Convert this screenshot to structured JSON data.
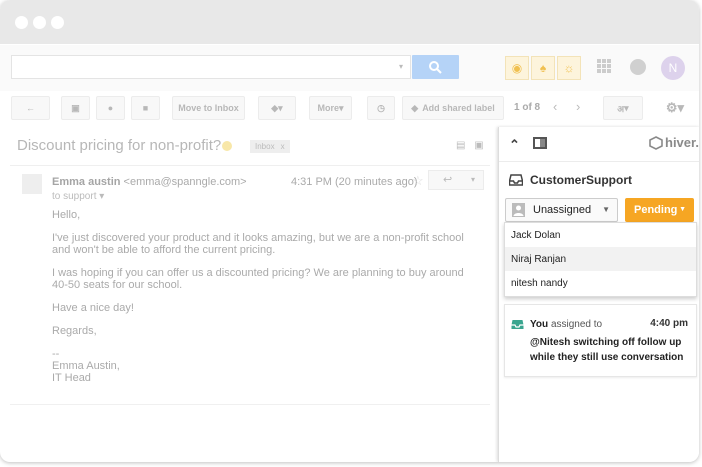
{
  "search": {
    "placeholder": ""
  },
  "account": {
    "avatar_letter": "N",
    "avatar_color": "#ddd2ec"
  },
  "toolbar": {
    "move_to_inbox": "Move to Inbox",
    "more": "More",
    "add_shared_label": "Add shared label",
    "pagination": "1 of 8",
    "lang": "अ"
  },
  "email": {
    "subject": "Discount pricing for non-profit?",
    "label": "Inbox",
    "label_close": "x",
    "sender_name": "Emma austin",
    "sender_email": "<emma@spanngle.com>",
    "time": "4:31 PM (20 minutes ago)",
    "to_line": "to support",
    "body": [
      "Hello,",
      "I've just discovered your product and it looks amazing, but we are a non-profit school and won't be able to afford the current pricing.",
      "I was hoping if you can offer us a discounted pricing? We are planning to buy around 40-50 seats for our school.",
      "Have a nice day!",
      "Regards,"
    ],
    "signature": [
      "--",
      "Emma Austin,",
      "IT Head"
    ]
  },
  "hiver": {
    "brand": "hiver.",
    "group": "CustomerSupport",
    "assignee": "Unassigned",
    "status": "Pending",
    "status_color": "#f6a623",
    "dropdown": [
      "Jack Dolan",
      "Niraj Ranjan",
      "nitesh nandy"
    ],
    "activity": {
      "actor": "You",
      "action": "assigned to",
      "time": "4:40 pm",
      "text": "@Nitesh switching off follow up while they still use conversation"
    }
  }
}
